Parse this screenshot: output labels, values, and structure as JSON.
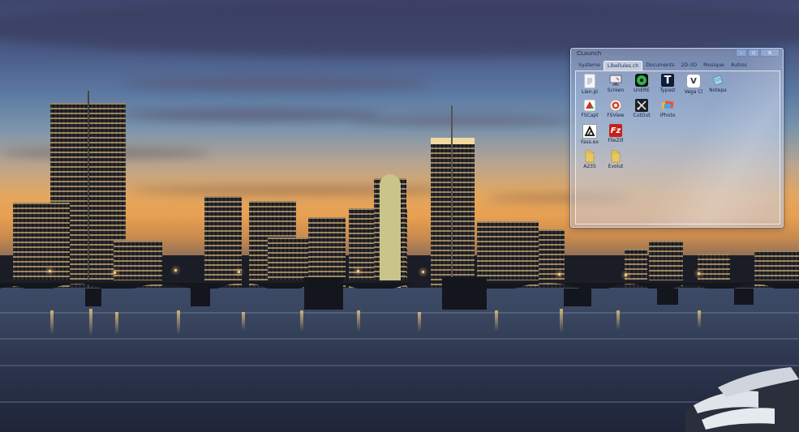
{
  "window": {
    "title": "CLaunch",
    "controls": {
      "minimize": "–",
      "restore": "▫",
      "close": "x"
    }
  },
  "tabs": [
    {
      "label": "Systeme",
      "active": false
    },
    {
      "label": "Libellules.ch",
      "active": true
    },
    {
      "label": "Documents",
      "active": false
    },
    {
      "label": "2D-3D",
      "active": false
    },
    {
      "label": "Musique",
      "active": false
    },
    {
      "label": "Autres",
      "active": false
    }
  ],
  "items": [
    {
      "label": "Lien.pl",
      "icon": "document-icon"
    },
    {
      "label": "Screen",
      "icon": "screen-icon"
    },
    {
      "label": "UnERE",
      "icon": "green-disc-icon"
    },
    {
      "label": "Typast",
      "icon": "typast-icon"
    },
    {
      "label": "Vega Cl",
      "icon": "vega-icon"
    },
    {
      "label": "Notepa",
      "icon": "notepad-icon"
    },
    {
      "label": "FSCapt",
      "icon": "fscapture-icon"
    },
    {
      "label": "FSView",
      "icon": "fsviewer-icon"
    },
    {
      "label": "CutOut",
      "icon": "cutout-icon"
    },
    {
      "label": "iPhoto",
      "icon": "iphoto-icon"
    },
    {
      "label": "Fass.ex",
      "icon": "fass-icon"
    },
    {
      "label": "FileZill",
      "icon": "filezilla-icon"
    },
    {
      "label": "A235",
      "icon": "folder-icon"
    },
    {
      "label": "Evolut",
      "icon": "folder-icon"
    }
  ],
  "colors": {
    "window_border": "#d2e1ff",
    "label_text": "#152040",
    "filezilla_red": "#c8201c",
    "folder_yellow": "#e8c660"
  }
}
